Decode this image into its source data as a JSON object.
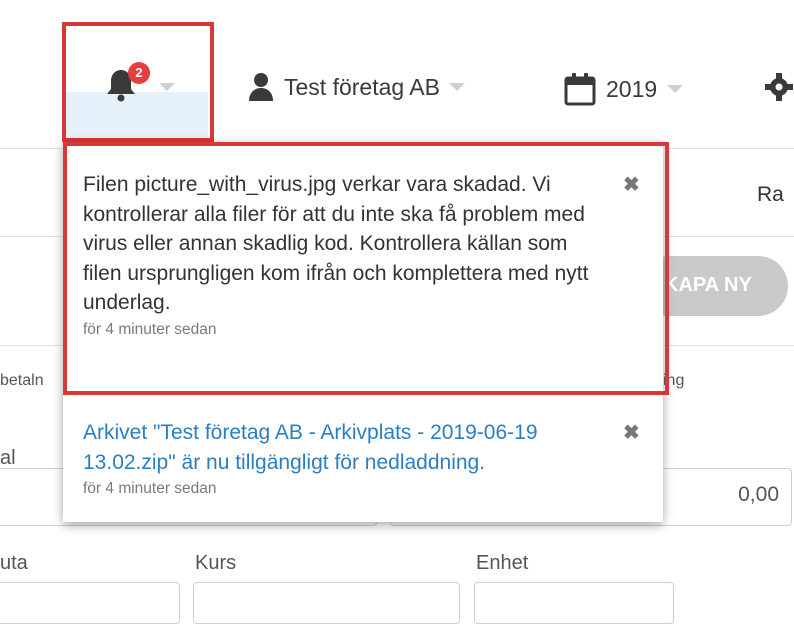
{
  "topbar": {
    "notification_badge": "2",
    "company": "Test företag AB",
    "year": "2019"
  },
  "background": {
    "tab_partial": "Ra",
    "create_button_partial": "KAPA NY",
    "col_left_partial": "betaln",
    "col_right_partial": "ing",
    "label_left_partial": "al",
    "amount_value": "0,00",
    "label_currency_partial": "uta",
    "label_rate": "Kurs",
    "label_unit": "Enhet"
  },
  "notifications": [
    {
      "message": "Filen picture_with_virus.jpg verkar vara skadad. Vi kontrollerar alla filer för att du inte ska få problem med virus eller annan skadlig kod. Kontrollera källan som filen ursprungligen kom ifrån och komplettera med nytt underlag.",
      "time": "för 4 minuter sedan",
      "close": "✖"
    },
    {
      "message": "Arkivet \"Test företag AB - Arkivplats - 2019-06-19 13.02.zip\" är nu tillgängligt för nedladdning.",
      "time": "för 4 minuter sedan",
      "close": "✖"
    }
  ],
  "icons": {
    "bell": "bell-icon",
    "user": "user-icon",
    "calendar": "calendar-icon",
    "settings": "gear-icon"
  },
  "colors": {
    "highlight_border": "#d93838",
    "badge": "#e63f3f",
    "link": "#2b7ec2",
    "hover_bg": "#e6f1fa"
  }
}
